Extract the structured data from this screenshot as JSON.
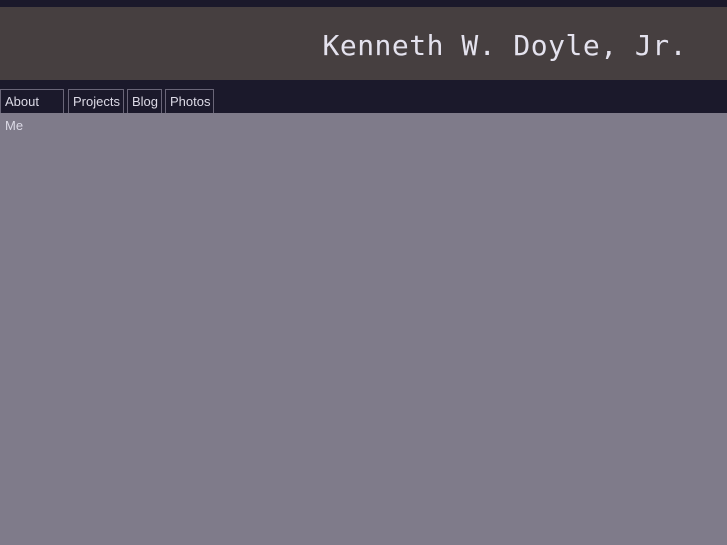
{
  "header": {
    "title": "Kenneth W. Doyle, Jr."
  },
  "nav": {
    "items": [
      {
        "label": "About Me"
      },
      {
        "label": "Projects"
      },
      {
        "label": "Blog"
      },
      {
        "label": "Photos"
      }
    ]
  }
}
